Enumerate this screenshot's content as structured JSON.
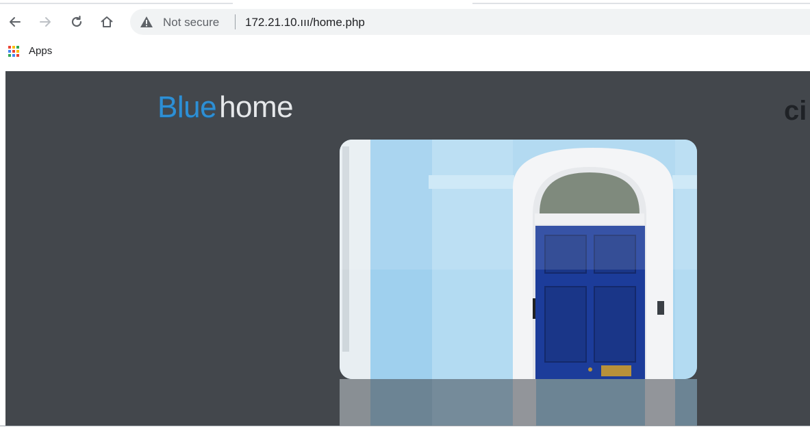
{
  "browser": {
    "nav": {
      "back_icon": "arrow-left-icon",
      "forward_icon": "arrow-right-icon",
      "reload_icon": "reload-icon",
      "home_icon": "home-icon"
    },
    "omnibox": {
      "security_icon": "warning-triangle-icon",
      "security_label": "Not secure",
      "url": "172.21.10.ııı/home.php"
    },
    "bookmarks": {
      "apps_icon": "apps-grid-icon",
      "apps_label": "Apps"
    }
  },
  "page": {
    "logo_blue": "Blue",
    "logo_home": "home",
    "corner_text": "ci",
    "hero_image": "blue-door-photo",
    "background_color": "#43474c",
    "accent_color": "#2e8fd4"
  }
}
